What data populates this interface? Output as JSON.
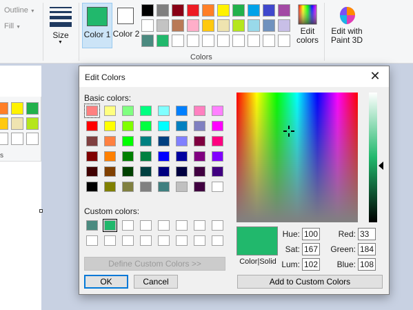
{
  "ribbon": {
    "shapes": {
      "outline_label": "Outline",
      "fill_label": "Fill"
    },
    "size_label": "Size",
    "color1_label": "Color 1",
    "color2_label": "Color 2",
    "color1_value": "#21b86c",
    "color2_value": "#ffffff",
    "colors_label": "Colors",
    "edit_colors_label": "Edit colors",
    "edit_paint3d_label": "Edit with Paint 3D",
    "palette": [
      "#000000",
      "#7f7f7f",
      "#880015",
      "#ed1c24",
      "#ff7f27",
      "#fff200",
      "#22b14c",
      "#00a2e8",
      "#3f48cc",
      "#a349a4",
      "#ffffff",
      "#c3c3c3",
      "#b97a57",
      "#ffaec9",
      "#ffc90e",
      "#efe4b0",
      "#b5e61d",
      "#99d9ea",
      "#7092be",
      "#c8bfe7",
      "#4b8a80",
      "#21b86c",
      "#ffffff",
      "#ffffff",
      "#ffffff",
      "#ffffff",
      "#ffffff",
      "#ffffff",
      "#ffffff",
      "#ffffff"
    ]
  },
  "bg_palette": {
    "colors": [
      "#ff7f27",
      "#fff200",
      "#22b14c",
      "#ffc90e",
      "#efe4b0",
      "#b5e61d",
      "#ffffff",
      "#ffffff",
      "#ffffff"
    ],
    "label_fragment": "s"
  },
  "dialog": {
    "title": "Edit Colors",
    "basic_colors_label": "Basic colors:",
    "custom_colors_label": "Custom colors:",
    "basic_colors": [
      "#ff8080",
      "#ffff80",
      "#80ff80",
      "#00ff80",
      "#80ffff",
      "#0080ff",
      "#ff80c0",
      "#ff80ff",
      "#ff0000",
      "#ffff00",
      "#80ff00",
      "#00ff40",
      "#00ffff",
      "#0080c0",
      "#8080c0",
      "#ff00ff",
      "#804040",
      "#ff8040",
      "#00ff00",
      "#008080",
      "#004080",
      "#8080ff",
      "#800040",
      "#ff0080",
      "#800000",
      "#ff8000",
      "#008000",
      "#008040",
      "#0000ff",
      "#0000a0",
      "#800080",
      "#8000ff",
      "#400000",
      "#804000",
      "#004000",
      "#004040",
      "#000080",
      "#000040",
      "#400040",
      "#400080",
      "#000000",
      "#808000",
      "#808040",
      "#808080",
      "#408080",
      "#c0c0c0",
      "#400040",
      "#ffffff"
    ],
    "custom_colors": [
      "#4b8a80",
      "#21b86c",
      "#ffffff",
      "#ffffff",
      "#ffffff",
      "#ffffff",
      "#ffffff",
      "#ffffff",
      "#ffffff",
      "#ffffff",
      "#ffffff",
      "#ffffff",
      "#ffffff",
      "#ffffff",
      "#ffffff",
      "#ffffff"
    ],
    "define_custom_label": "Define Custom Colors >>",
    "ok_label": "OK",
    "cancel_label": "Cancel",
    "preview_color": "#21b86c",
    "preview_label": "Color|Solid",
    "hue_label": "Hue:",
    "hue_value": "100",
    "sat_label": "Sat:",
    "sat_value": "167",
    "lum_label": "Lum:",
    "lum_value": "102",
    "red_label": "Red:",
    "red_value": "33",
    "green_label": "Green:",
    "green_value": "184",
    "blue_label": "Blue:",
    "blue_value": "108",
    "add_custom_label": "Add to Custom Colors"
  }
}
